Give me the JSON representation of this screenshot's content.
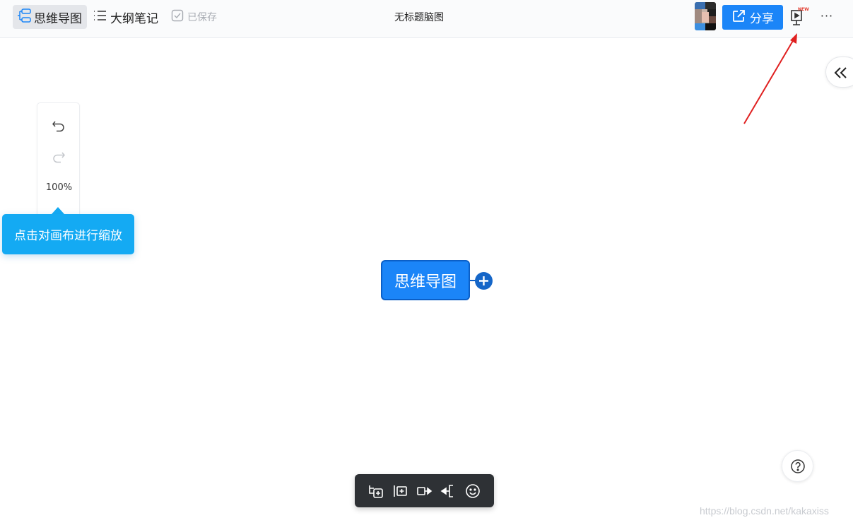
{
  "header": {
    "tab_mindmap": "思维导图",
    "tab_outline": "大纲笔记",
    "save_status": "已保存",
    "doc_title": "无标题脑图",
    "share_label": "分享",
    "present_badge": "NEW",
    "more_label": "···"
  },
  "canvas": {
    "zoom_level": "100%",
    "tooltip_text": "点击对画布进行缩放",
    "central_node": "思维导图"
  },
  "watermark": "https://blog.csdn.net/kakaxiss",
  "icons": {
    "mindmap_tab": "mindmap-icon",
    "outline_tab": "list-icon",
    "saved": "checkbox-icon",
    "share": "external-link-icon",
    "present": "presentation-icon",
    "collapse": "double-chevron-left-icon",
    "undo": "undo-icon",
    "redo": "redo-icon",
    "add": "plus-circle-icon",
    "help": "question-icon",
    "toolbar": [
      "add-child-topic-icon",
      "add-sibling-topic-icon",
      "add-relation-icon",
      "add-summary-icon",
      "emoji-icon"
    ]
  },
  "colors": {
    "accent": "#1b85f8",
    "node_border": "#0b5fc7",
    "tooltip": "#14aaf3",
    "toolbar_bg": "#2e3135",
    "annotation": "#e02020"
  }
}
